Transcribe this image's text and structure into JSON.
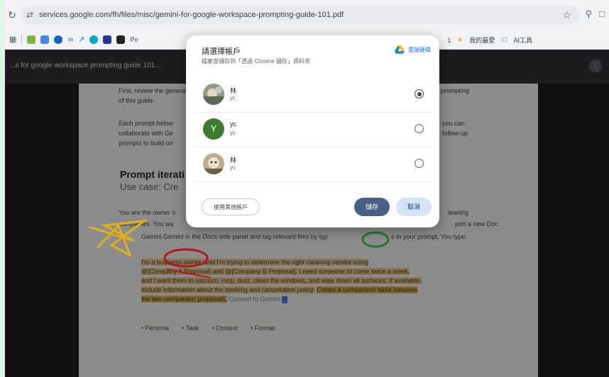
{
  "browser": {
    "url": "services.google.com/fh/files/misc/gemini-for-google-workspace-prompting-guide-101.pdf",
    "bookmarks_right": [
      "1",
      "我的最愛",
      "AI工具"
    ]
  },
  "pdf": {
    "title": "...s for google workspace prompting guide 101...",
    "para1a": "First, review the general",
    "para1b": "of this guide.",
    "para1r": "prompting",
    "para2a": "Each prompt below",
    "para2b": "collaborate with Ge",
    "para2c": "prompts to build on",
    "para2r1": "you can",
    "para2r2": "follow-up",
    "heading": "Prompt iterati",
    "usecase": "Use case: Cre",
    "body1": "You are the owner o",
    "body1r": "leaning",
    "body2": "companies. You wa",
    "body2r": "port a new Doc",
    "body3": "Gemini Gemini in the Docs side panel and tag relevant files by typ",
    "body3r": "e in your prompt. You type:",
    "prompt_text_1": "I'm a business owner, and I'm trying to determine the right cleaning vendor using",
    "prompt_text_2": "@[Company A Proposal] and @[Company B Proposal]. I need someone to come twice a week,",
    "prompt_text_3": "and I want them to vacuum, mop, dust, clean the windows, and wipe down all surfaces. If available,",
    "prompt_text_4": "include information about the booking and cancellation policy.",
    "prompt_text_5": "Create a comparison table between",
    "prompt_text_6": "the two companies' proposals.",
    "prompt_text_7": "Convert to Gemini",
    "tags": [
      "• Persona",
      "• Task",
      "• Context",
      "• Format"
    ]
  },
  "dialog": {
    "title": "請選擇帳戶",
    "subtitle": "檔案會儲存到「透過 Chrome 儲存」資料夾",
    "drive_label": "雲端硬碟",
    "accounts": [
      {
        "name": "林",
        "email": "yc",
        "selected": true,
        "avatar": "photo-1"
      },
      {
        "name": "yc",
        "email": "yc",
        "selected": false,
        "avatar": "Y"
      },
      {
        "name": "林",
        "email": "yc",
        "selected": false,
        "avatar": "photo-2"
      }
    ],
    "other_account": "使用其他帳戶",
    "save": "儲存",
    "cancel": "取消",
    "avatar_letter": "Y",
    "colors": {
      "save_bg": "#4a5f86",
      "cancel_bg": "#d3e3fd",
      "avatar_y": "#3c7d2e"
    }
  }
}
